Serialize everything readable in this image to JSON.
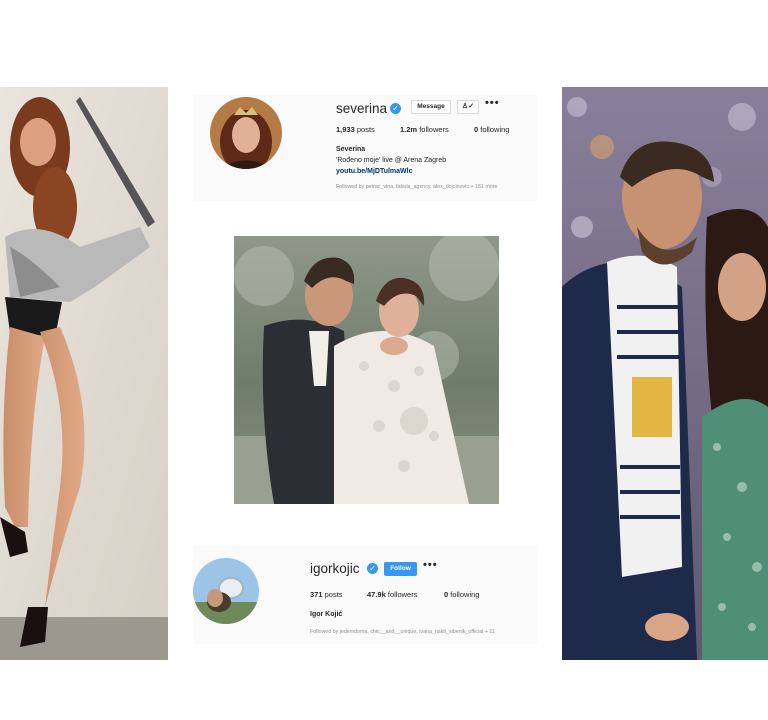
{
  "top_profile": {
    "username": "severina",
    "message_label": "Message",
    "follow_icon": "person-check-icon",
    "more_label": "•••",
    "posts_count": "1,933",
    "posts_label": "posts",
    "followers_count": "1.2m",
    "followers_label": "followers",
    "following_count": "0",
    "following_label": "following",
    "full_name": "Severina",
    "bio": "'Rođeno moje' live @ Arena Zagreb",
    "link": "youtu.be/MjDTulmaWlc",
    "followed_by": "Followed by petrac_vina, fabula_agency, alex_dojcinovic + 161 more"
  },
  "bottom_profile": {
    "username": "igorkojic",
    "follow_label": "Follow",
    "more_label": "•••",
    "posts_count": "371",
    "posts_label": "posts",
    "followers_count": "47.9k",
    "followers_label": "followers",
    "following_count": "0",
    "following_label": "following",
    "full_name": "Igor Kojić",
    "followed_by": "Followed by jedemdoma, chic__and__unique, ivana_nakit_sibenik_official + 11"
  },
  "colors": {
    "verified": "#3897f0",
    "follow_button": "#3897f0",
    "link": "#003569",
    "muted": "#8e8e8e",
    "card_bg": "#fafafa"
  },
  "icons": {
    "verified": "verified-badge-icon",
    "more": "more-dots-icon"
  }
}
